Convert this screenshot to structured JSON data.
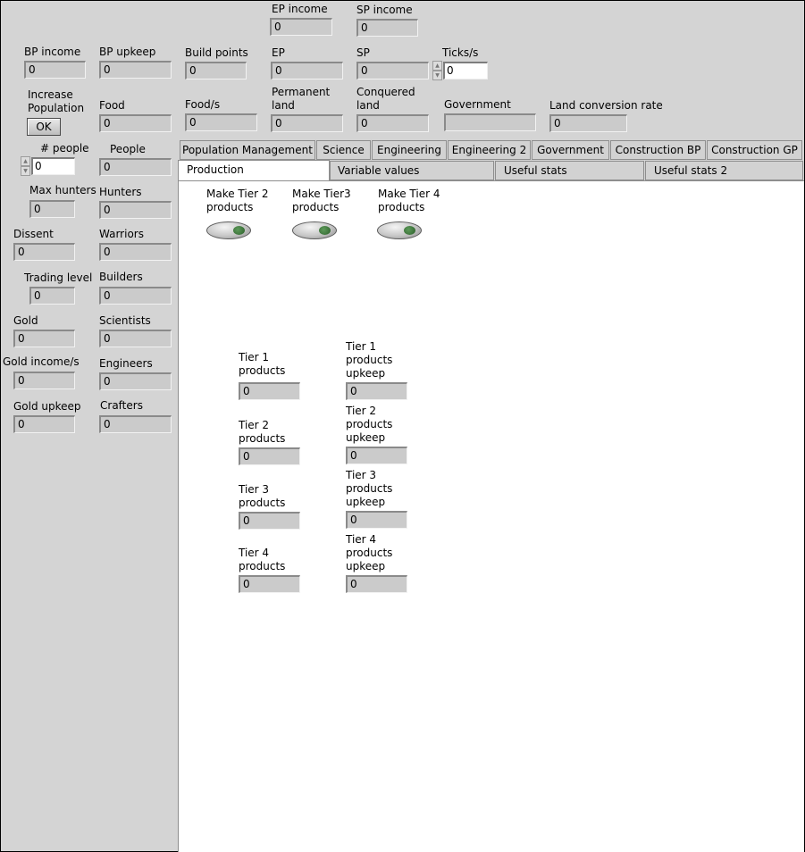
{
  "top": {
    "ep_income": {
      "label": "EP income",
      "value": "0"
    },
    "sp_income": {
      "label": "SP income",
      "value": "0"
    },
    "bp_income": {
      "label": "BP income",
      "value": "0"
    },
    "bp_upkeep": {
      "label": "BP upkeep",
      "value": "0"
    },
    "build_points": {
      "label": "Build points",
      "value": "0"
    },
    "ep": {
      "label": "EP",
      "value": "0"
    },
    "sp": {
      "label": "SP",
      "value": "0"
    },
    "ticks": {
      "label": "Ticks/s",
      "value": "0"
    },
    "increase_population": {
      "label_1": "Increase",
      "label_2": "Population",
      "button": "OK"
    },
    "food": {
      "label": "Food",
      "value": "0"
    },
    "food_s": {
      "label": "Food/s",
      "value": "0"
    },
    "permanent_land": {
      "label_1": "Permanent",
      "label_2": "land",
      "value": "0"
    },
    "conquered_land": {
      "label_1": "Conquered",
      "label_2": "land",
      "value": "0"
    },
    "government": {
      "label": "Government",
      "value": ""
    },
    "land_conversion_rate": {
      "label": "Land conversion rate",
      "value": "0"
    }
  },
  "left": {
    "num_people": {
      "label": "# people",
      "value": "0"
    },
    "people": {
      "label": "People",
      "value": "0"
    },
    "max_hunters": {
      "label": "Max hunters",
      "value": "0"
    },
    "hunters": {
      "label": "Hunters",
      "value": "0"
    },
    "dissent": {
      "label": "Dissent",
      "value": "0"
    },
    "warriors": {
      "label": "Warriors",
      "value": "0"
    },
    "trading_level": {
      "label": "Trading level",
      "value": "0"
    },
    "builders": {
      "label": "Builders",
      "value": "0"
    },
    "gold": {
      "label": "Gold",
      "value": "0"
    },
    "scientists": {
      "label": "Scientists",
      "value": "0"
    },
    "gold_income": {
      "label": "Gold income/s",
      "value": "0"
    },
    "engineers": {
      "label": "Engineers",
      "value": "0"
    },
    "gold_upkeep": {
      "label": "Gold upkeep",
      "value": "0"
    },
    "crafters": {
      "label": "Crafters",
      "value": "0"
    }
  },
  "tabs_row1": [
    "Population Management",
    "Science",
    "Engineering",
    "Engineering 2",
    "Government",
    "Construction BP",
    "Construction GP"
  ],
  "tabs_row2": [
    "Production",
    "Variable values",
    "Useful stats",
    "Useful stats 2"
  ],
  "production": {
    "make_tier2": {
      "label_1": "Make Tier 2",
      "label_2": "products"
    },
    "make_tier3": {
      "label_1": "Make Tier3",
      "label_2": "products"
    },
    "make_tier4": {
      "label_1": "Make Tier 4",
      "label_2": "products"
    },
    "tier1": {
      "l1": "Tier 1",
      "l2": "products",
      "value": "0"
    },
    "tier1_upkeep": {
      "l1": "Tier 1",
      "l2": "products",
      "l3": "upkeep",
      "value": "0"
    },
    "tier2": {
      "l1": "Tier 2",
      "l2": "products",
      "value": "0"
    },
    "tier2_upkeep": {
      "l1": "Tier 2",
      "l2": "products",
      "l3": "upkeep",
      "value": "0"
    },
    "tier3": {
      "l1": "Tier 3",
      "l2": "products",
      "value": "0"
    },
    "tier3_upkeep": {
      "l1": "Tier 3",
      "l2": "products",
      "l3": "upkeep",
      "value": "0"
    },
    "tier4": {
      "l1": "Tier 4",
      "l2": "products",
      "value": "0"
    },
    "tier4_upkeep": {
      "l1": "Tier 4",
      "l2": "products",
      "l3": "upkeep",
      "value": "0"
    }
  }
}
